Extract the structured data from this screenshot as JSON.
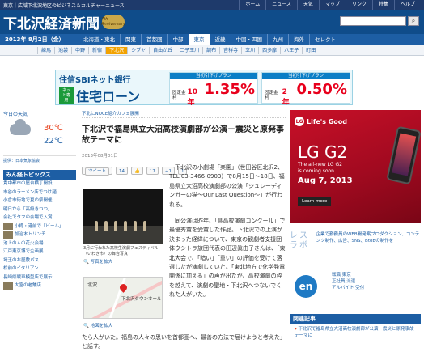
{
  "topbar": {
    "tagline": "東京｜広域下北沢地区のビジネス＆カルチャーニュース",
    "links": [
      "ホーム",
      "ニュース",
      "天気",
      "マップ",
      "リンク",
      "特集",
      "ヘルプ"
    ]
  },
  "header": {
    "logo": "下北沢経済新聞",
    "anniversary": "7th Anniversary",
    "search_icon": "magnifier-icon"
  },
  "nav": {
    "date": "2013年 8月2日",
    "date_weekday": "（金）",
    "regions": [
      "北海道・東北",
      "関東",
      "首都圏",
      "中部",
      "東京",
      "近畿",
      "中国・四国",
      "九州",
      "海外",
      "セレクト"
    ],
    "active_region": "東京",
    "areas": [
      "練馬",
      "池袋",
      "中野",
      "新宿",
      "下北沢",
      "シブヤ",
      "自由が丘",
      "二子玉川",
      "調布",
      "吉祥寺",
      "立川",
      "西多摩",
      "八王子",
      "町田"
    ],
    "active_area": "下北沢"
  },
  "banner": {
    "bank": "住信SBIネット銀行",
    "net": "ネット専用",
    "product": "住宅ローン",
    "offer1_head": "当初引下げプラン",
    "offer1_kind": "固定金利",
    "offer1_years": "10年",
    "offer1_rate": "1.35%",
    "offer2_head": "当初引下げプラン",
    "offer2_kind": "固定金利",
    "offer2_years": "2年",
    "offer2_rate": "0.50%"
  },
  "weather": {
    "title": "今日の天気",
    "high": "30℃",
    "low": "22℃",
    "icon": "cloud-icon",
    "note": "提供：日本気象協会"
  },
  "topics": {
    "heading": "みん経トピックス",
    "items": [
      "貴中都市の屋台横丁開設",
      "市谷のラーメン店でつけ麺",
      "小倉市街地で夏の祭開催",
      "明日から「高級きつつ」",
      "会社でタフの会場で入賞",
      "小樽・港前で「ビール」",
      "加治木トリンチ",
      "池上の人の花火会場",
      "江戸東京博で企画展",
      "埼玉のお屋敷パス",
      "松前のイタリアン",
      "長崎県戦車模型店で展示",
      "大宮の老舗店"
    ]
  },
  "article": {
    "breadcrumb": "下北にNOCE紹介カフェ展開",
    "title": "下北沢で福島県立大沼高校演劇部が公演－震災と原発事故テーマに",
    "date": "2013年08月01日",
    "tweet": "ツイート",
    "tweet_count": "14",
    "like_count": "17",
    "plus_count": "1",
    "photo_caption": "3月に行われた高校生演劇フェスティバル（いわき市）の舞台写真",
    "photo_link": "写真を拡大",
    "map_label_main": "北沢",
    "map_label_place": "下北沢タウンホール",
    "map_link": "地図を拡大",
    "para1": "下北沢の小劇場「楽園」（世田谷区北沢2、TEL 03-3466-0903）で8月15日～18日、福島県立大沼高校演劇部の公演「シュレーディンガーの猫～Our Last Question～」が行われる。",
    "para2": "同公演は昨年、「県高校演劇コンクール」で最優秀賞を受賞した作品。下北沢での上演が決まった経緯について、東京の観劇者支援団体ウシトラ旅団代表の田辺眞由子さんは、「東北大会で、「暗い」「重い」の評価を受けて落選したが演劇していた。「東北地方で化学発電開係に加える」の声が出たが、高校演劇の枠を越えて、演劇の聖地・下北沢へつないでくれた人がいた。",
    "para3": "たら人がいた。福島の人々の思いを首都圏へ、最善の方法で届けようと考えた」と話す。"
  },
  "lg_ad": {
    "brand": "LG",
    "brand_full": "Life's Good",
    "model": "LG G2",
    "tagline1": "The all-new LG G2",
    "tagline2": "is coming soon",
    "date": "Aug 7, 2013",
    "button": "Learn more"
  },
  "rebo": {
    "logo": "レスラボ",
    "text": "企業で勤務員のWEB開発案プロダクション、コンテンツ制作、広告、SNS、BtoBの制作を"
  },
  "en_ad": {
    "logo": "en",
    "text1": "転職 東京",
    "text2": "正社員 派遣",
    "text3": "アルバイト 受付"
  },
  "related": {
    "heading": "関連記事",
    "items": [
      "下北沢で福島県立大沼高校演劇部が公演－震災と原発事故テーマに"
    ]
  }
}
